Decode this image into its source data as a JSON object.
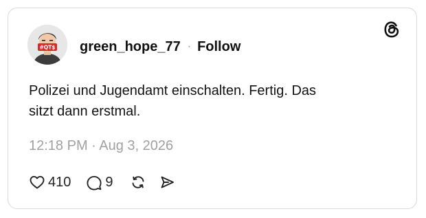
{
  "post": {
    "username": "green_hope_77",
    "separator": "·",
    "follow_label": "Follow",
    "text": "Polizei und Jugendamt einschalten. Fertig. Das\nsitzt dann erstmal.",
    "timestamp": "12:18 PM · Aug 3, 2026",
    "likes": "410",
    "replies": "9",
    "avatar_badge_text": "#QT$"
  },
  "icons": {
    "logo": "threads-logo-icon",
    "like": "heart-icon",
    "reply": "speech-bubble-icon",
    "repost": "repost-icon",
    "share": "send-icon"
  },
  "colors": {
    "text": "#101010",
    "muted": "#a0a0a0",
    "border": "#d9d9d9"
  }
}
